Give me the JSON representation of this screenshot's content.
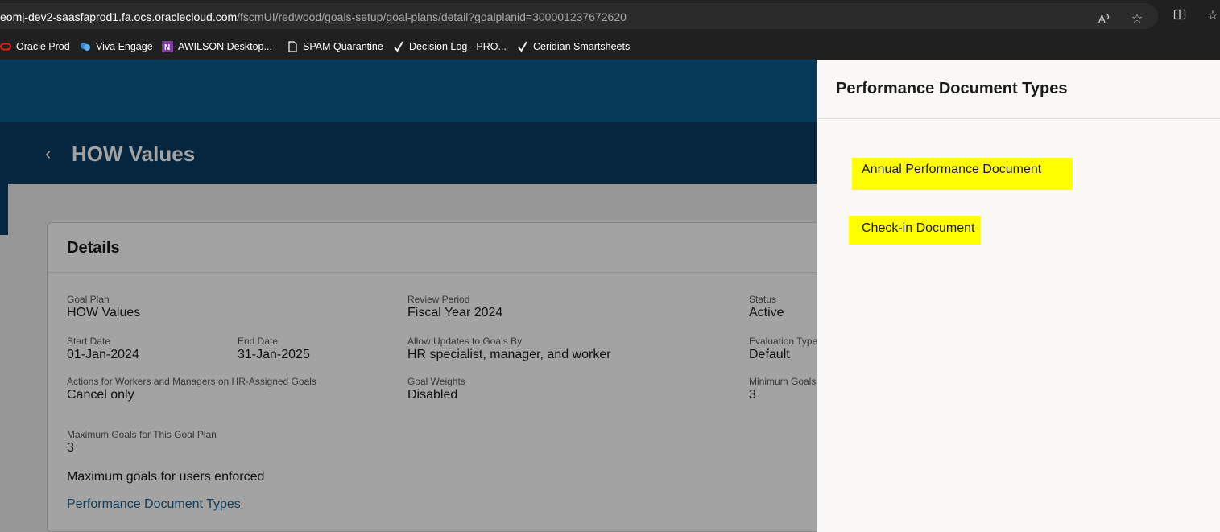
{
  "browser": {
    "url_host": "eomj-dev2-saasfaprod1.fa.ocs.oraclecloud.com",
    "url_path": "/fscmUI/redwood/goals-setup/goal-plans/detail?goalplanid=300001237672620",
    "icons": [
      "read-aloud-icon",
      "favorite-star-icon",
      "split-screen-icon",
      "favorites-icon"
    ]
  },
  "bookmarks": [
    {
      "label": "Oracle Prod",
      "icon": "oracle-icon",
      "color": "#e2231a"
    },
    {
      "label": "Viva Engage",
      "icon": "viva-engage-icon",
      "color": "#3b82d6"
    },
    {
      "label": "AWILSON Desktop...",
      "icon": "onenote-icon",
      "color": "#7b3fa0"
    },
    {
      "label": "SPAM Quarantine",
      "icon": "page-icon",
      "color": "#ffffff"
    },
    {
      "label": "Decision Log - PRO...",
      "icon": "checkmark-icon",
      "color": "#ffffff"
    },
    {
      "label": "Ceridian Smartsheets",
      "icon": "checkmark-icon",
      "color": "#ffffff"
    }
  ],
  "page": {
    "title": "HOW Values"
  },
  "details": {
    "title": "Details",
    "goal_plan_label": "Goal Plan",
    "goal_plan_value": "HOW Values",
    "review_period_label": "Review Period",
    "review_period_value": "Fiscal Year 2024",
    "status_label": "Status",
    "status_value": "Active",
    "start_date_label": "Start Date",
    "start_date_value": "01-Jan-2024",
    "end_date_label": "End Date",
    "end_date_value": "31-Jan-2025",
    "allow_updates_label": "Allow Updates to Goals By",
    "allow_updates_value": "HR specialist, manager, and worker",
    "evaluation_type_label": "Evaluation Type",
    "evaluation_type_value": "Default",
    "actions_label": "Actions for Workers and Managers on HR-Assigned Goals",
    "actions_value": "Cancel only",
    "goal_weights_label": "Goal Weights",
    "goal_weights_value": "Disabled",
    "minimum_goals_label": "Minimum Goals",
    "minimum_goals_value": "3",
    "maximum_goals_label": "Maximum Goals for This Goal Plan",
    "maximum_goals_value": "3",
    "max_enforced_note": "Maximum goals for users enforced",
    "perf_doc_types_link": "Performance Document Types"
  },
  "drawer": {
    "title": "Performance Document Types",
    "items": [
      "Annual Performance Document",
      "Check-in Document"
    ],
    "highlight_color": "#ffff00"
  },
  "colors": {
    "banner_primary": "#0c5b8a",
    "banner_secondary": "#0a3a63",
    "link": "#1c5f8c"
  }
}
